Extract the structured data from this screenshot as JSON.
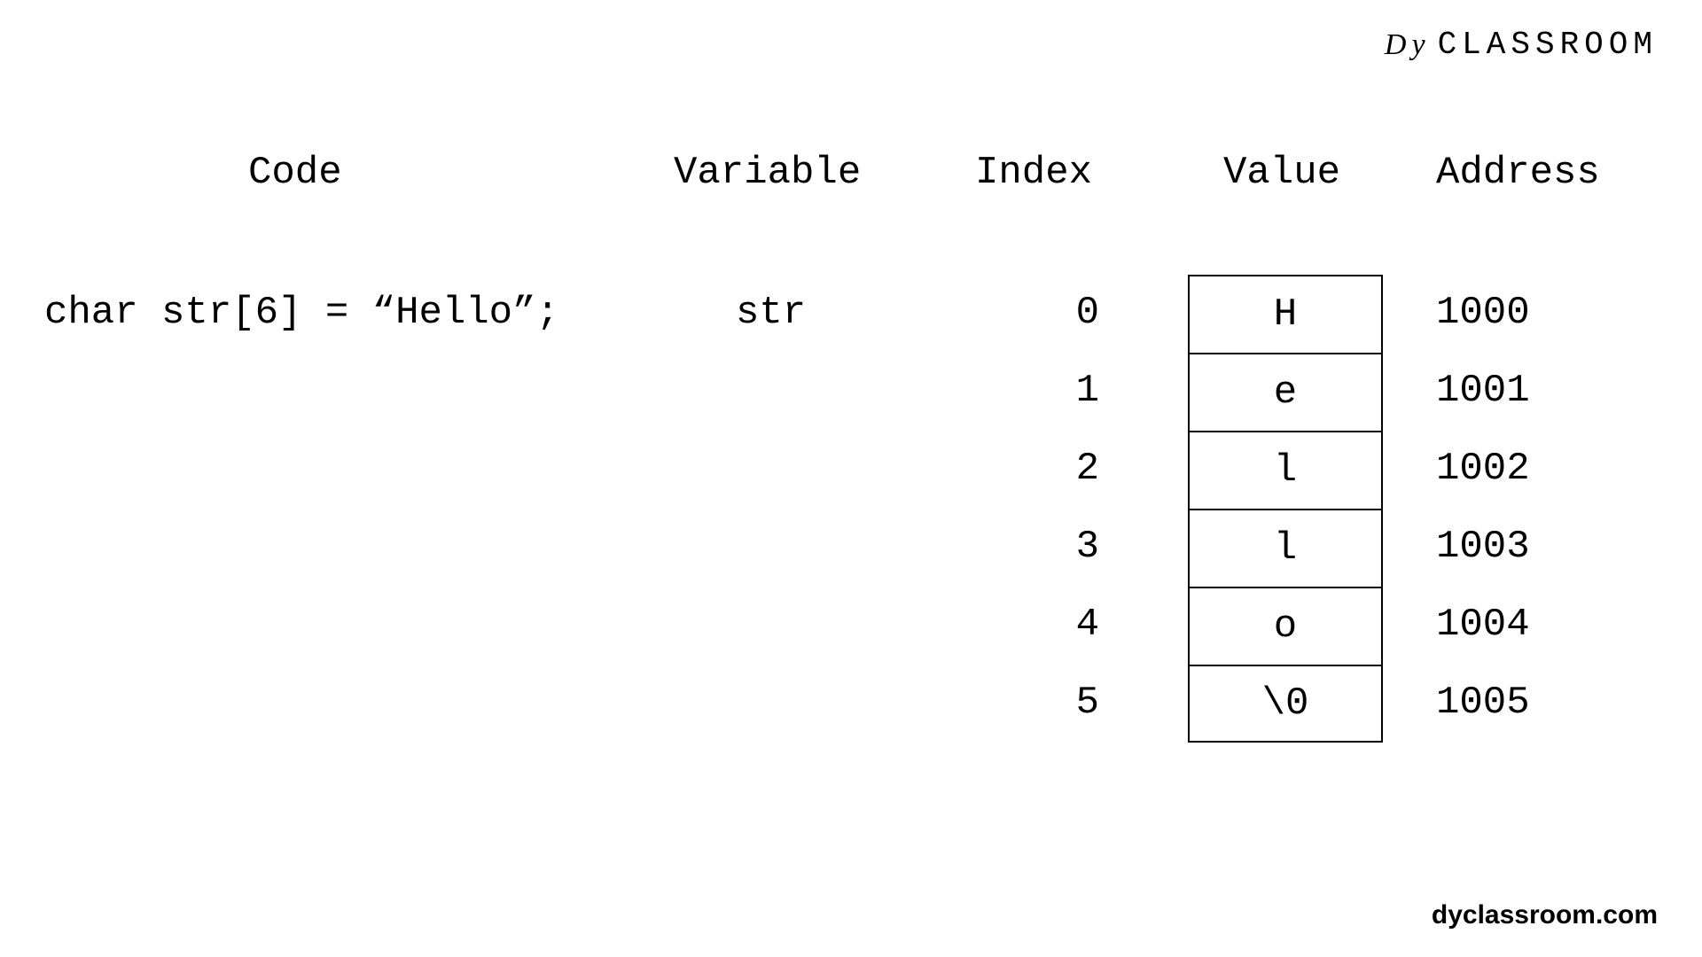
{
  "brand": {
    "logo_prefix": "Dy",
    "logo_text": "CLASSROOM"
  },
  "headers": {
    "code": "Code",
    "variable": "Variable",
    "index": "Index",
    "value": "Value",
    "address": "Address"
  },
  "code_line": "char str[6] = “Hello”;",
  "variable_name": "str",
  "memory": [
    {
      "index": "0",
      "value": "H",
      "address": "1000"
    },
    {
      "index": "1",
      "value": "e",
      "address": "1001"
    },
    {
      "index": "2",
      "value": "l",
      "address": "1002"
    },
    {
      "index": "3",
      "value": "l",
      "address": "1003"
    },
    {
      "index": "4",
      "value": "o",
      "address": "1004"
    },
    {
      "index": "5",
      "value": "\\0",
      "address": "1005"
    }
  ],
  "footer": "dyclassroom.com"
}
